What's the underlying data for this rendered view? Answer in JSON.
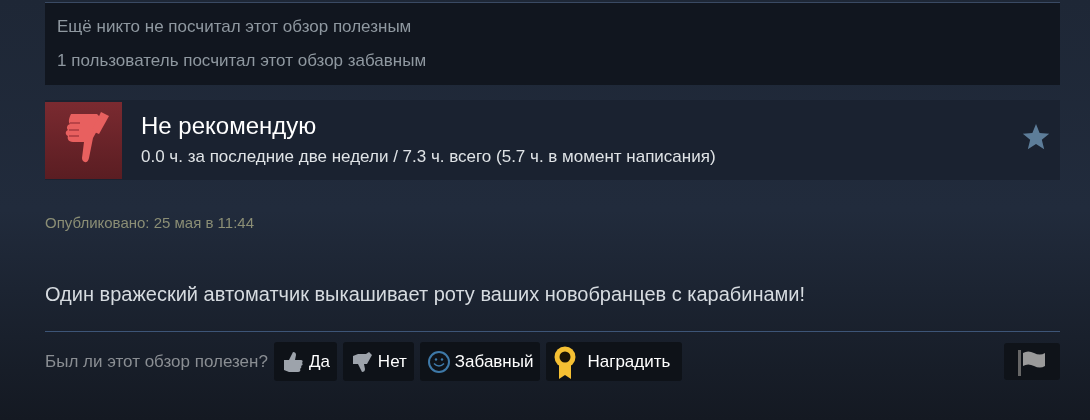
{
  "stats": [
    "Ещё никто не посчитал этот обзор полезным",
    "1 пользователь посчитал этот обзор забавным"
  ],
  "review": {
    "verdict": "Не рекомендую",
    "recommended": false,
    "hours": "0.0 ч. за последние две недели / 7.3 ч. всего (5.7 ч. в момент написания)",
    "published": "Опубликовано: 25 мая в 11:44",
    "text": "Один вражеский автоматчик выкашивает роту ваших новобранцев с карабинами!"
  },
  "feedback": {
    "prompt": "Был ли этот обзор полезен?",
    "buttons": [
      {
        "kind": "yes",
        "label": "Да"
      },
      {
        "kind": "no",
        "label": "Нет"
      },
      {
        "kind": "funny",
        "label": "Забавный"
      },
      {
        "kind": "award",
        "label": "Наградить"
      }
    ]
  }
}
